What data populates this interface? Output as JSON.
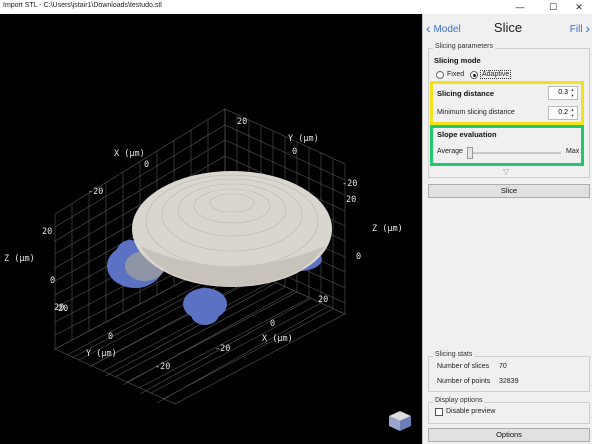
{
  "window": {
    "title": "Import STL - C:\\Users\\jstair1\\Downloads\\testudo.stl",
    "controls": {
      "minimize": "—",
      "maximize": "☐",
      "close": "✕"
    }
  },
  "viewport": {
    "axis_labels": {
      "x_top": "X (μm)",
      "y_top": "Y (μm)",
      "z_left": "Z (μm)",
      "z_right": "Z (μm)",
      "x_bottom": "X (μm)",
      "y_bottom": "Y (μm)"
    },
    "ticks": {
      "x_top_0": "0",
      "x_top_m20": "-20",
      "y_top_20": "20",
      "y_top_0": "0",
      "y_top_m20": "-20",
      "z_left_20a": "20",
      "z_left_0": "0",
      "z_left_20b": "20",
      "z_right_20": "20",
      "z_right_0": "0",
      "x_bot_20": "20",
      "x_bot_0": "0",
      "x_bot_m20": "-20",
      "y_bot_20": "20",
      "y_bot_0": "0",
      "y_bot_m20": "-20"
    }
  },
  "panel": {
    "nav": {
      "back": "Model",
      "title": "Slice",
      "forward": "Fill"
    },
    "slicing_parameters": {
      "caption": "Slicing parameters",
      "mode_label": "Slicing mode",
      "mode_options": [
        "Fixed",
        "Adaptive"
      ],
      "mode_selected": "Adaptive",
      "distance_label": "Slicing distance",
      "distance_value": "0.3",
      "min_distance_label": "Minimum slicing distance",
      "min_distance_value": "0.2",
      "slope_label": "Slope evaluation",
      "slope_min": "Average",
      "slope_max": "Max",
      "slope_position": 0.0
    },
    "expand_icon": "chevron-down-icon",
    "slice_button": "Slice",
    "stats": {
      "caption": "Slicing stats",
      "slices_label": "Number of slices",
      "slices_value": "70",
      "points_label": "Number of points",
      "points_value": "32839"
    },
    "display": {
      "caption": "Display options",
      "disable_preview": "Disable preview",
      "disable_preview_checked": false
    },
    "options_button": "Options"
  },
  "colors": {
    "highlight_yellow": "#f2e21a",
    "highlight_green": "#1fc86e",
    "link_blue": "#3a6fd0",
    "shell": "#d9d6cf",
    "limbs": "#5b72c4"
  }
}
